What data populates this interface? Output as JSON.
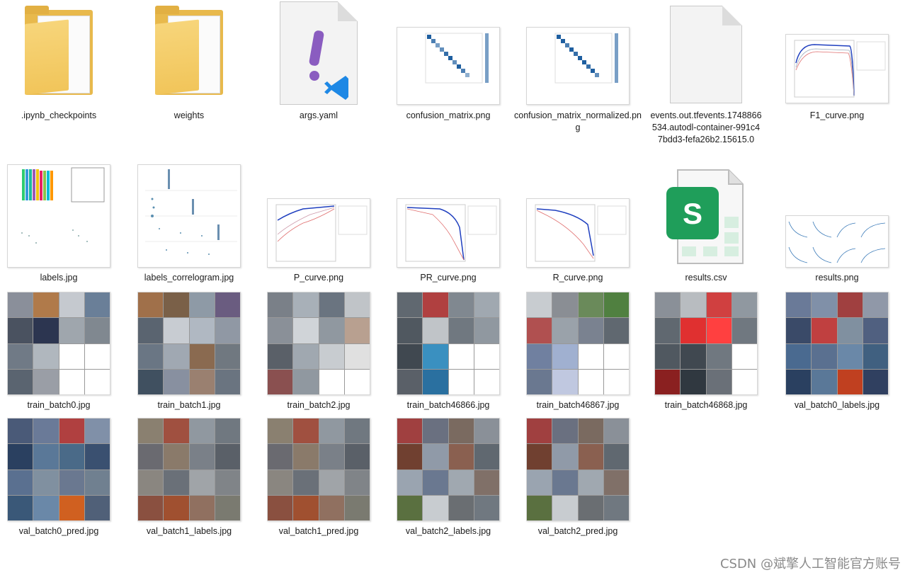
{
  "files": [
    {
      "name": ".ipynb_checkpoints",
      "kind": "folder"
    },
    {
      "name": "weights",
      "kind": "folder"
    },
    {
      "name": "args.yaml",
      "kind": "yaml"
    },
    {
      "name": "confusion_matrix.png",
      "kind": "image"
    },
    {
      "name": "confusion_matrix_normalized.png",
      "kind": "image"
    },
    {
      "name": "events.out.tfevents.1748866534.autodl-container-991c47bdd3-fefa26b2.15615.0",
      "kind": "document"
    },
    {
      "name": "F1_curve.png",
      "kind": "image"
    },
    {
      "name": "labels.jpg",
      "kind": "image"
    },
    {
      "name": "labels_correlogram.jpg",
      "kind": "image"
    },
    {
      "name": "P_curve.png",
      "kind": "image"
    },
    {
      "name": "PR_curve.png",
      "kind": "image"
    },
    {
      "name": "R_curve.png",
      "kind": "image"
    },
    {
      "name": "results.csv",
      "kind": "spreadsheet"
    },
    {
      "name": "results.png",
      "kind": "image"
    },
    {
      "name": "train_batch0.jpg",
      "kind": "image"
    },
    {
      "name": "train_batch1.jpg",
      "kind": "image"
    },
    {
      "name": "train_batch2.jpg",
      "kind": "image"
    },
    {
      "name": "train_batch46866.jpg",
      "kind": "image"
    },
    {
      "name": "train_batch46867.jpg",
      "kind": "image"
    },
    {
      "name": "train_batch46868.jpg",
      "kind": "image"
    },
    {
      "name": "val_batch0_labels.jpg",
      "kind": "image"
    },
    {
      "name": "val_batch0_pred.jpg",
      "kind": "image"
    },
    {
      "name": "val_batch1_labels.jpg",
      "kind": "image"
    },
    {
      "name": "val_batch1_pred.jpg",
      "kind": "image"
    },
    {
      "name": "val_batch2_labels.jpg",
      "kind": "image"
    },
    {
      "name": "val_batch2_pred.jpg",
      "kind": "image"
    }
  ],
  "watermark": "CSDN @斌擎人工智能官方账号",
  "colors": {
    "folder": "#e8b94c",
    "yaml_accent": "#8a5cc0",
    "vscode_blue": "#1e88e5",
    "sheet_green": "#1f9e5a",
    "matrix_blue": "#1f5fa0"
  }
}
